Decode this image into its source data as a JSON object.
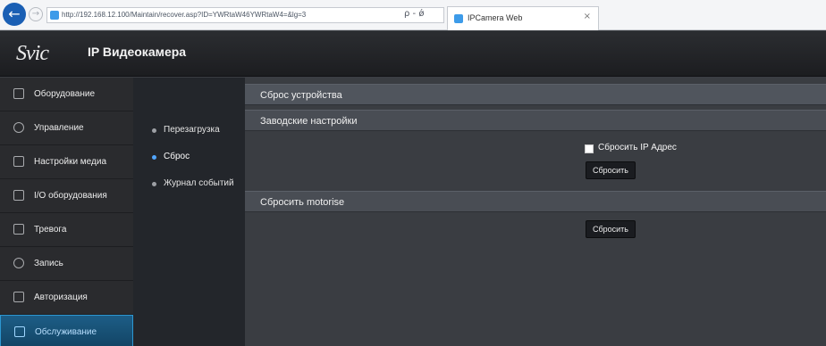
{
  "browser": {
    "url": "http://192.168.12.100/Maintain/recover.asp?ID=YWRtaW46YWRtaW4=&lg=3",
    "tools": "ρ - ǿ",
    "tab_title": "IPCamera Web",
    "tab_close": "×",
    "back_icon": "←",
    "forward_icon": "→"
  },
  "app": {
    "logo_text": "Svic",
    "title": "IP Видеокамера"
  },
  "sidebar": {
    "items": [
      {
        "label": "Оборудование",
        "icon": "camera-icon"
      },
      {
        "label": "Управление",
        "icon": "gear-icon"
      },
      {
        "label": "Настройки медиа",
        "icon": "media-icon"
      },
      {
        "label": "I/O оборудования",
        "icon": "io-icon"
      },
      {
        "label": "Тревога",
        "icon": "alarm-icon"
      },
      {
        "label": "Запись",
        "icon": "record-icon"
      },
      {
        "label": "Авторизация",
        "icon": "monitor-icon"
      },
      {
        "label": "Обслуживание",
        "icon": "wrench-icon"
      }
    ],
    "active": "Обслуживание"
  },
  "submenu": {
    "items": [
      {
        "label": "Перезагрузка"
      },
      {
        "label": "Сброс"
      },
      {
        "label": "Журнал событий"
      }
    ],
    "active": "Сброс"
  },
  "main": {
    "section_reset_device": "Сброс устройства",
    "section_factory": "Заводские настройки",
    "reset_ip_label": "Сбросить IP Адрес",
    "reset_button_label": "Сбросить",
    "section_motorise": "Сбросить motorise",
    "motorise_button_label": "Сбросить"
  },
  "colors": {
    "accent": "#2d97d1",
    "active_dot": "#51a6ff",
    "sidebar_bg": "#2a2b2e",
    "main_bg": "#3a3d42"
  }
}
